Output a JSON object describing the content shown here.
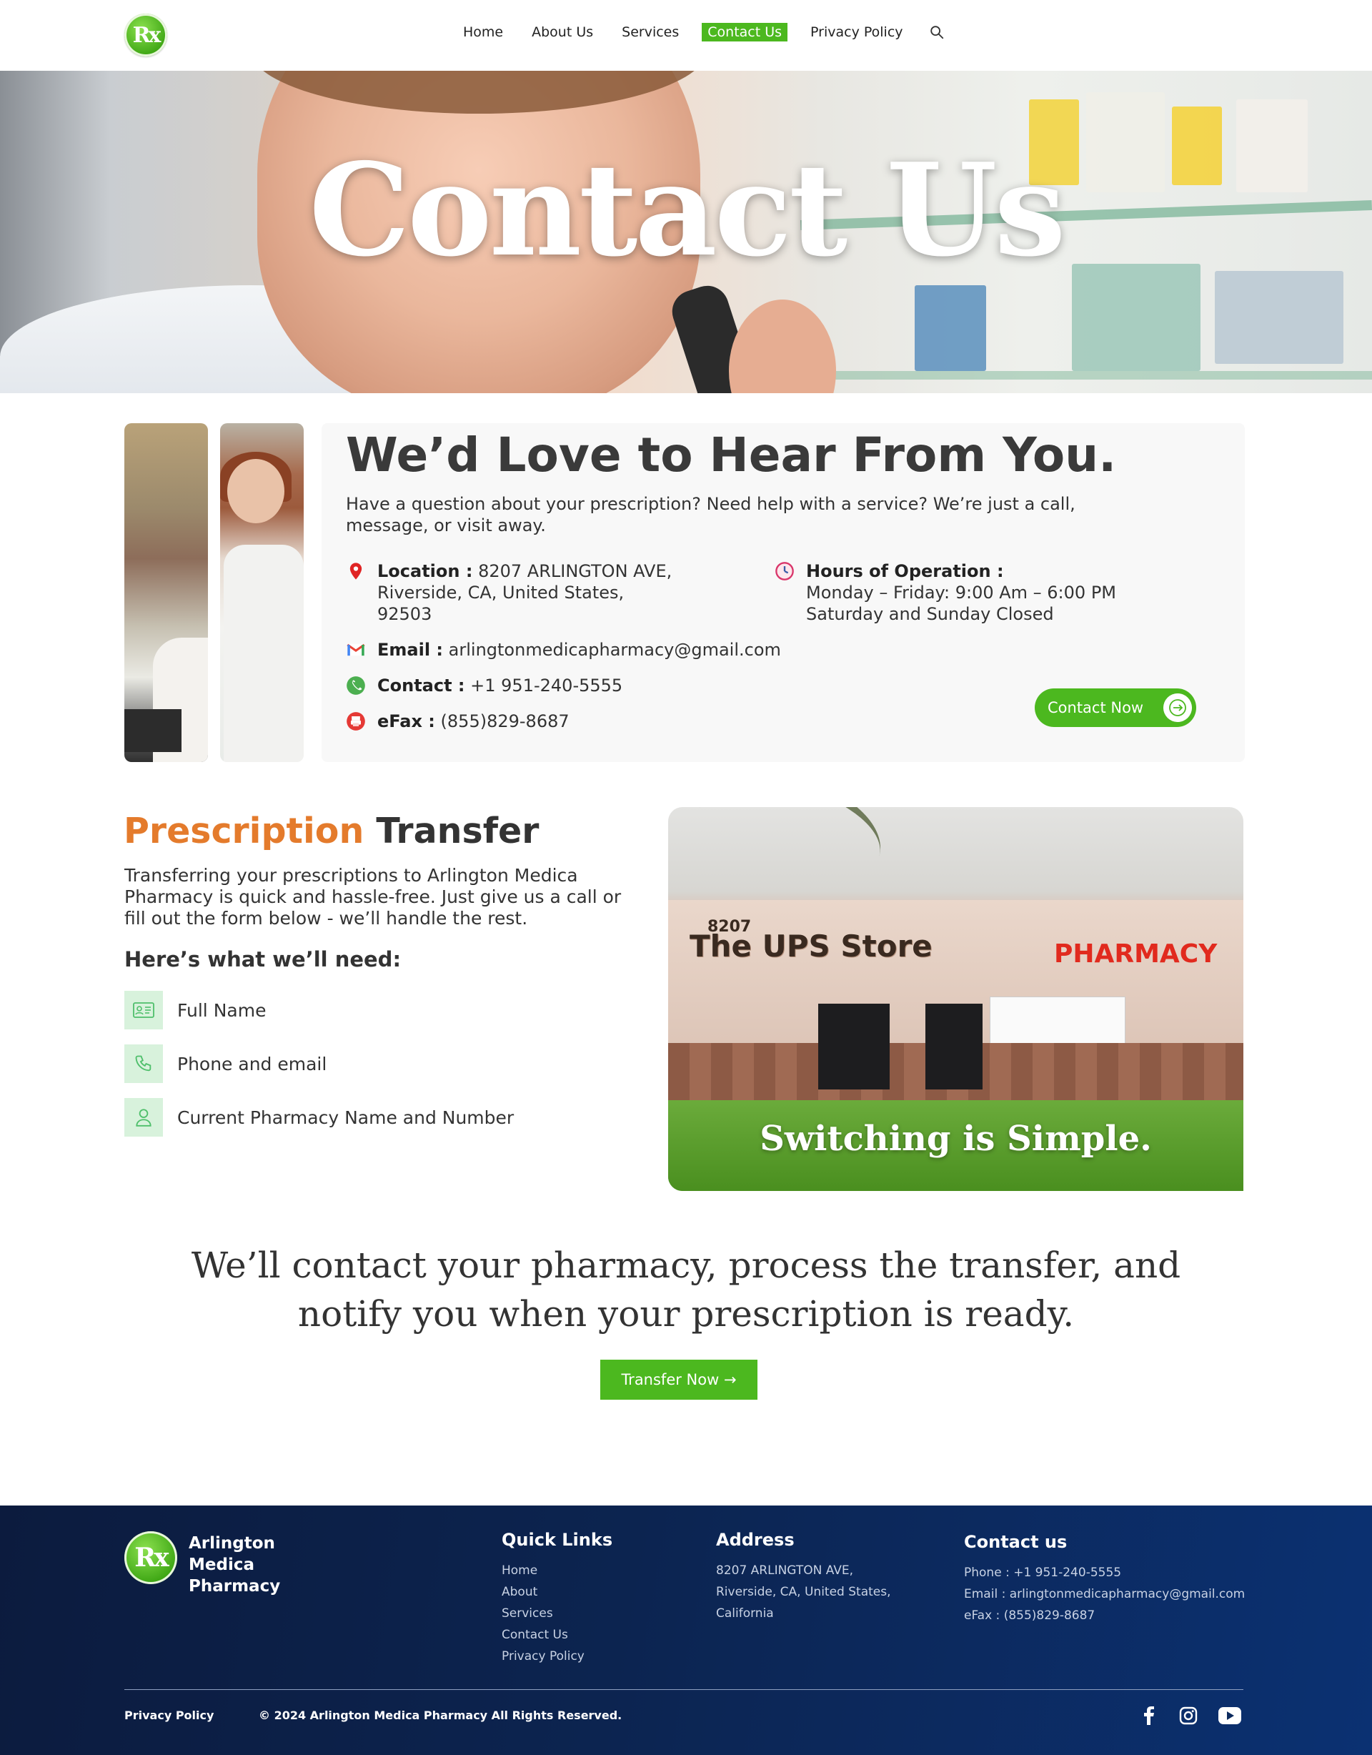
{
  "header": {
    "logo_text": "Rx",
    "nav": [
      "Home",
      "About Us",
      "Services",
      "Contact Us",
      "Privacy Policy"
    ],
    "active_nav": "Contact Us",
    "search_icon": "search-icon"
  },
  "hero": {
    "title": "Contact Us"
  },
  "contact": {
    "title": "We’d Love to Hear From You.",
    "subtitle": "Have a question about your prescription? Need help with a service? We’re just a call, message, or visit away.",
    "location_label": "Location :",
    "location_line1": "8207 ARLINGTON AVE,",
    "location_line2": "Riverside, CA, United States,",
    "location_line3": "92503",
    "hours_label": "Hours of Operation :",
    "hours_line1": "Monday – Friday: 9:00 Am – 6:00 PM",
    "hours_line2": "Saturday and Sunday Closed",
    "email_label": "Email :",
    "email_value": "arlingtonmedicapharmacy@gmail.com",
    "phone_label": "Contact :",
    "phone_value": "+1 951-240-5555",
    "fax_label": "eFax :",
    "fax_value": "(855)829-8687",
    "button": "Contact Now",
    "colors": {
      "location_pin": "#e02424",
      "clock": "#d9366b",
      "phone": "#4caf50",
      "fax": "#e53935"
    }
  },
  "transfer": {
    "title_accent": "Prescription",
    "title_rest": "Transfer",
    "body": "Transferring your prescriptions to Arlington Medica Pharmacy is quick and hassle-free. Just give us a call or fill out the form below - we’ll handle the rest.",
    "need_heading": "Here’s what we’ll need:",
    "needs": [
      "Full Name",
      "Phone and email",
      "Current Pharmacy Name and Number"
    ],
    "image_caption": "Switching is Simple.",
    "store_number": "8207",
    "store_sign": "The UPS Store",
    "pharmacy_sign": "PHARMACY",
    "quote": "We’ll contact your pharmacy, process the transfer, and notify you when your prescription is ready.",
    "button": "Transfer Now →"
  },
  "footer": {
    "brand": "Arlington Medica Pharmacy",
    "quick_links_title": "Quick Links",
    "quick_links": [
      "Home",
      "About",
      "Services",
      "Contact Us",
      "Privacy Policy"
    ],
    "address_title": "Address",
    "address_lines": [
      "8207 ARLINGTON AVE,",
      "Riverside, CA, United States,",
      "California"
    ],
    "contact_title": "Contact us",
    "contact_lines": [
      "Phone : +1 951-240-5555",
      "Email : arlingtonmedicapharmacy@gmail.com",
      "eFax : (855)829-8687"
    ],
    "bottom_privacy": "Privacy Policy",
    "copyright": "© 2024 Arlington Medica Pharmacy All Rights Reserved.",
    "social_icons": [
      "facebook-icon",
      "instagram-icon",
      "youtube-icon"
    ]
  },
  "colors": {
    "brand_green": "#4cb81f",
    "accent_orange": "#e47b2c",
    "footer_navy": "#0c2450"
  }
}
